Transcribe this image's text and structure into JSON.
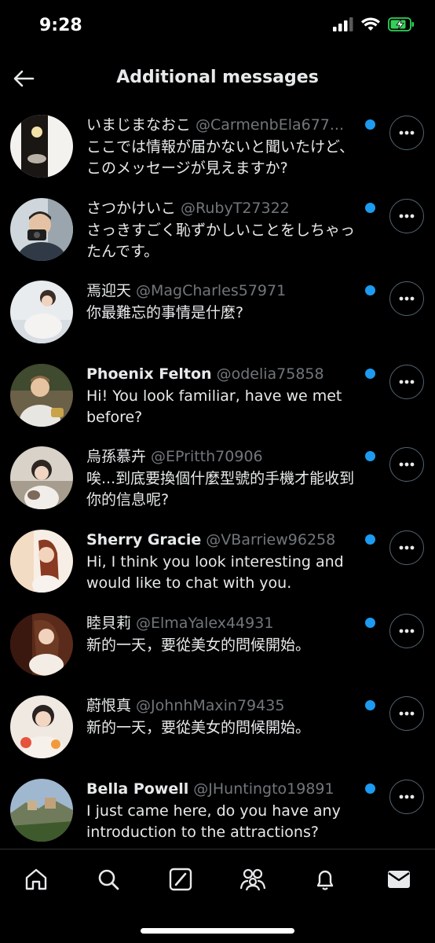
{
  "status_bar": {
    "time": "9:28"
  },
  "header": {
    "title": "Additional messages"
  },
  "messages": [
    {
      "name": "いまじまなおこ",
      "handle": "@CarmenbEla677...",
      "text": "ここでは情報が届かないと聞いたけど、このメッセージが見えますか?"
    },
    {
      "name": "さつかけいこ",
      "handle": "@RubyT27322",
      "text": "さっきすごく恥ずかしいことをしちゃったんです。"
    },
    {
      "name": "焉迎天",
      "handle": "@MagCharles57971",
      "text": "你最難忘的事情是什麼?"
    },
    {
      "name": "Phoenix Felton",
      "handle": "@odelia75858",
      "text": "Hi! You look familiar, have we met before?"
    },
    {
      "name": "烏孫慕卉",
      "handle": "@EPritth70906",
      "text": "唉...到底要換個什麼型號的手機才能收到你的信息呢?"
    },
    {
      "name": "Sherry Gracie",
      "handle": "@VBarriew96258",
      "text": "Hi, I think you look interesting and would like to chat with you."
    },
    {
      "name": "睦貝莉",
      "handle": "@ElmaYalex44931",
      "text": "新的一天，要從美女的問候開始。"
    },
    {
      "name": "蔚恨真",
      "handle": "@JohnhMaxin79435",
      "text": "新的一天，要從美女的問候開始。"
    },
    {
      "name": "Bella Powell",
      "handle": "@JHuntingto19891",
      "text": "I just came here, do you have any introduction to the attractions?"
    }
  ],
  "tabs": [
    "home-icon",
    "search-icon",
    "grok-icon",
    "communities-icon",
    "notifications-icon",
    "messages-icon"
  ],
  "colors": {
    "background": "#000000",
    "unread_dot": "#1d9bf0",
    "handle": "#71767b",
    "battery": "#30d158"
  }
}
